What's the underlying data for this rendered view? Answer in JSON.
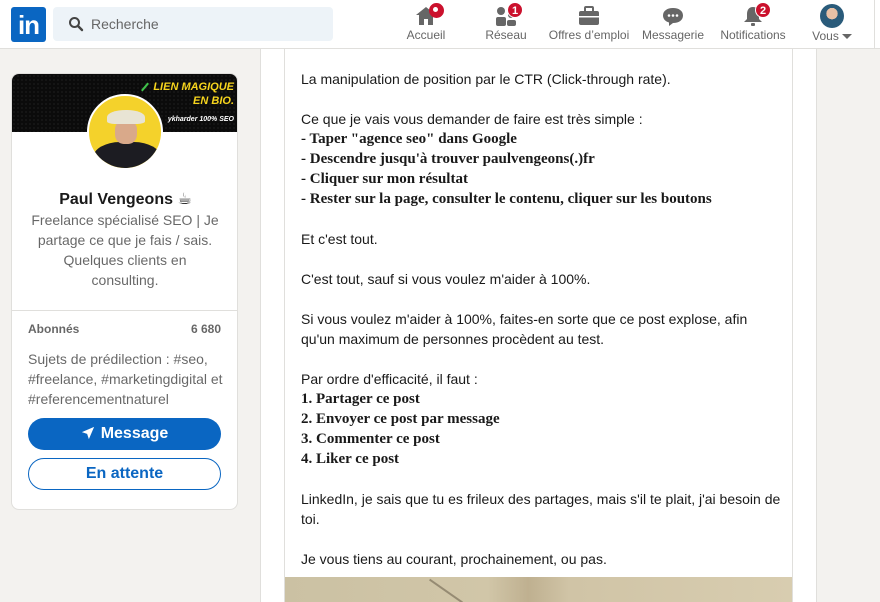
{
  "header": {
    "logo_text": "in",
    "search_placeholder": "Recherche",
    "nav": [
      {
        "label": "Accueil",
        "icon": "home-icon",
        "badge": "dot"
      },
      {
        "label": "Réseau",
        "icon": "network-icon",
        "badge": "1"
      },
      {
        "label": "Offres d’emploi",
        "icon": "briefcase-icon",
        "badge": ""
      },
      {
        "label": "Messagerie",
        "icon": "messaging-icon",
        "badge": ""
      },
      {
        "label": "Notifications",
        "icon": "bell-icon",
        "badge": "2"
      },
      {
        "label": "Vous",
        "icon": "avatar",
        "badge": ""
      }
    ]
  },
  "profile": {
    "banner_line1": "LIEN MAGIQUE",
    "banner_line2": "EN BIO.",
    "banner_line3": "ykharder 100% SEO",
    "name": "Paul Vengeons ☕",
    "headline": "Freelance spécialisé SEO | Je partage ce que je fais / sais. Quelques clients en consulting.",
    "followers_label": "Abonnés",
    "followers_value": "6 680",
    "topics": "Sujets de prédilection : #seo, #freelance, #marketingdigital et #referencementnaturel",
    "message_button": "Message",
    "pending_button": "En attente"
  },
  "post": {
    "lines": [
      {
        "text": "La manipulation de position par le CTR (Click-through rate).",
        "bold": false
      },
      {
        "text": "",
        "bold": false
      },
      {
        "text": "Ce que je vais vous demander de faire est très simple :",
        "bold": false
      },
      {
        "text": "- Taper \"agence seo\" dans Google",
        "bold": true
      },
      {
        "text": "- Descendre jusqu'à trouver paulvengeons(.)fr",
        "bold": true
      },
      {
        "text": "- Cliquer sur mon résultat",
        "bold": true
      },
      {
        "text": "- Rester sur la page, consulter le contenu, cliquer sur les boutons",
        "bold": true
      },
      {
        "text": "",
        "bold": false
      },
      {
        "text": "Et c'est tout.",
        "bold": false
      },
      {
        "text": "",
        "bold": false
      },
      {
        "text": "C'est tout, sauf si vous voulez m'aider à 100%.",
        "bold": false
      },
      {
        "text": "",
        "bold": false
      },
      {
        "text": "Si vous voulez m'aider à 100%, faites-en sorte que ce post explose, afin qu'un maximum de personnes procèdent au test.",
        "bold": false
      },
      {
        "text": "",
        "bold": false
      },
      {
        "text": "Par ordre d'efficacité, il faut :",
        "bold": false
      },
      {
        "text": "1. Partager ce post",
        "bold": true
      },
      {
        "text": "2. Envoyer ce post par message",
        "bold": true
      },
      {
        "text": "3. Commenter ce post",
        "bold": true
      },
      {
        "text": "4. Liker ce post",
        "bold": true
      },
      {
        "text": "",
        "bold": false
      },
      {
        "text": "LinkedIn, je sais que tu es frileux des partages, mais s'il te plait, j'ai besoin de toi.",
        "bold": false
      },
      {
        "text": "",
        "bold": false
      },
      {
        "text": "Je vous tiens au courant, prochainement, ou pas.",
        "bold": false
      }
    ]
  }
}
